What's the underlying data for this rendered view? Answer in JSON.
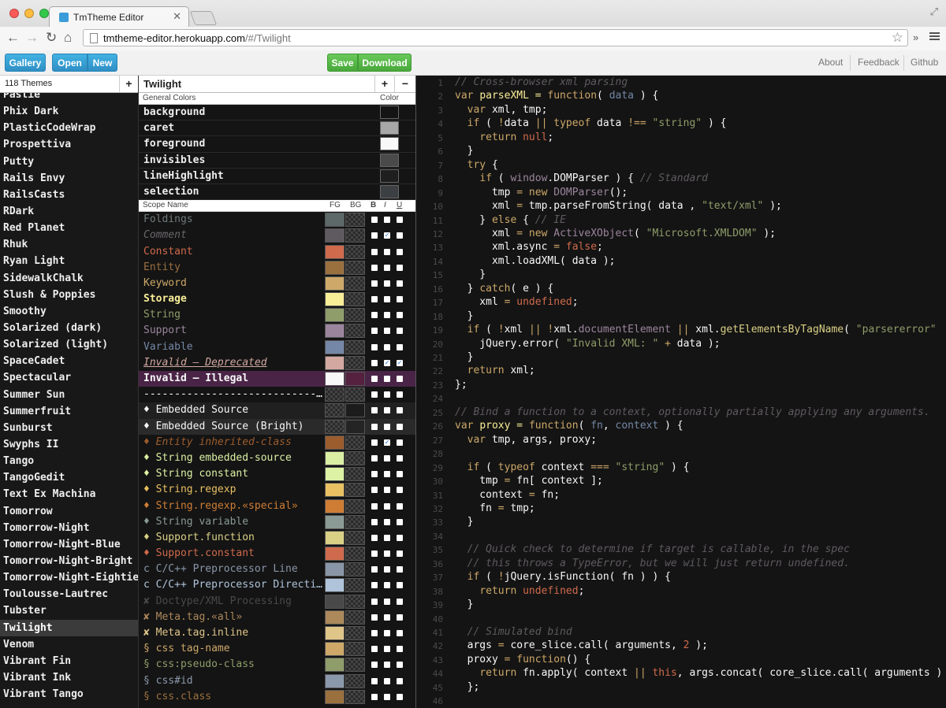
{
  "browser": {
    "tab_title": "TmTheme Editor",
    "url_host": "tmtheme-editor.herokuapp.com",
    "url_path": "/#/Twilight"
  },
  "appbar": {
    "gallery": "Gallery",
    "open": "Open",
    "new": "New",
    "save": "Save",
    "download": "Download",
    "about": "About",
    "feedback": "Feedback",
    "github": "Github"
  },
  "themes": {
    "count_label": "118 Themes",
    "add": "+",
    "selected": "Twilight",
    "items": [
      "Pastie",
      "Phix Dark",
      "PlasticCodeWrap",
      "Prospettiva",
      "Putty",
      "Rails Envy",
      "RailsCasts",
      "RDark",
      "Red Planet",
      "Rhuk",
      "Ryan Light",
      "SidewalkChalk",
      "Slush & Poppies",
      "Smoothy",
      "Solarized (dark)",
      "Solarized (light)",
      "SpaceCadet",
      "Spectacular",
      "Summer Sun",
      "Summerfruit",
      "Sunburst",
      "Swyphs II",
      "Tango",
      "TangoGedit",
      "Text Ex Machina",
      "Tomorrow",
      "Tomorrow-Night",
      "Tomorrow-Night-Blue",
      "Tomorrow-Night-Bright",
      "Tomorrow-Night-Eighties",
      "Toulousse-Lautrec",
      "Tubster",
      "Twilight",
      "Venom",
      "Vibrant Fin",
      "Vibrant Ink",
      "Vibrant Tango"
    ]
  },
  "editor": {
    "title": "Twilight",
    "add": "+",
    "remove": "−",
    "general_header": "General Colors",
    "color_header": "Color",
    "scope_header": "Scope Name",
    "fg_header": "FG",
    "bg_header": "BG",
    "b_header": "B",
    "i_header": "I",
    "u_header": "U",
    "general": [
      {
        "name": "background",
        "color": "#141414"
      },
      {
        "name": "caret",
        "color": "#a7a7a7"
      },
      {
        "name": "foreground",
        "color": "#f8f8f8"
      },
      {
        "name": "invisibles",
        "color": "#4a4a4a"
      },
      {
        "name": "lineHighlight",
        "color": "#1f1f1f"
      },
      {
        "name": "selection",
        "color": "#3c4043"
      }
    ],
    "scopes": [
      {
        "name": "Foldings",
        "fg": "#5c6968",
        "color": "#6f7a7a",
        "b": false,
        "i": false,
        "u": false
      },
      {
        "name": "Comment",
        "fg": "#5f5a60",
        "color": "#6a666b",
        "italic": true,
        "b": false,
        "i": true,
        "u": false
      },
      {
        "name": "Constant",
        "fg": "#cf6a4c",
        "color": "#cf6a4c",
        "b": false,
        "i": false,
        "u": false
      },
      {
        "name": "Entity",
        "fg": "#9b703f",
        "color": "#9b703f",
        "b": false,
        "i": false,
        "u": false
      },
      {
        "name": "Keyword",
        "fg": "#cda869",
        "color": "#cda869",
        "b": false,
        "i": false,
        "u": false
      },
      {
        "name": "Storage",
        "fg": "#f9ee98",
        "color": "#f9ee98",
        "bold": true,
        "b": false,
        "i": false,
        "u": false
      },
      {
        "name": "String",
        "fg": "#8f9d6a",
        "color": "#8f9d6a",
        "b": false,
        "i": false,
        "u": false
      },
      {
        "name": "Support",
        "fg": "#9b859d",
        "color": "#9b859d",
        "b": false,
        "i": false,
        "u": false
      },
      {
        "name": "Variable",
        "fg": "#7587a6",
        "color": "#7587a6",
        "b": false,
        "i": false,
        "u": false
      },
      {
        "name": "Invalid – Deprecated",
        "fg": "#d2a8a1",
        "color": "#d2a8a1",
        "italic": true,
        "underline": true,
        "b": false,
        "i": true,
        "u": true
      },
      {
        "name": "Invalid – Illegal",
        "fg": "#f8f8f8",
        "bgc": "#56203f",
        "color": "#f8f8f8",
        "rowbg": "#4a2447",
        "bold": true,
        "b": false,
        "i": false,
        "u": false
      },
      {
        "name": "-----------------------------------------------",
        "fg": "",
        "color": "#ffffff",
        "b": false,
        "i": false,
        "u": false
      },
      {
        "name": "♦ Embedded Source",
        "fg": "",
        "bgc": "#1c1c1c",
        "color": "#f8f8f8",
        "rowbg": "#202020",
        "b": false,
        "i": false,
        "u": false
      },
      {
        "name": "♦ Embedded Source (Bright)",
        "fg": "",
        "bgc": "#242424",
        "color": "#f8f8f8",
        "rowbg": "#2a2a2a",
        "b": false,
        "i": false,
        "u": false
      },
      {
        "name": "♦ Entity inherited-class",
        "fg": "#9b5c2e",
        "color": "#9b5c2e",
        "italic": true,
        "b": false,
        "i": true,
        "u": false
      },
      {
        "name": "♦ String embedded-source",
        "fg": "#daefa3",
        "color": "#daefa3",
        "b": false,
        "i": false,
        "u": false
      },
      {
        "name": "♦ String constant",
        "fg": "#ddf2a4",
        "color": "#ddf2a4",
        "b": false,
        "i": false,
        "u": false
      },
      {
        "name": "♦ String.regexp",
        "fg": "#e9c062",
        "color": "#e9c062",
        "b": false,
        "i": false,
        "u": false
      },
      {
        "name": "♦ String.regexp.«special»",
        "fg": "#cf7d34",
        "color": "#cf7d34",
        "b": false,
        "i": false,
        "u": false
      },
      {
        "name": "♦ String variable",
        "fg": "#8a9a95",
        "color": "#8a9a95",
        "b": false,
        "i": false,
        "u": false
      },
      {
        "name": "♦ Support.function",
        "fg": "#dad085",
        "color": "#dad085",
        "b": false,
        "i": false,
        "u": false
      },
      {
        "name": "♦ Support.constant",
        "fg": "#cf6a4c",
        "color": "#cf6a4c",
        "b": false,
        "i": false,
        "u": false
      },
      {
        "name": "c C/C++ Preprocessor Line",
        "fg": "#8996a8",
        "color": "#8996a8",
        "b": false,
        "i": false,
        "u": false
      },
      {
        "name": "c C/C++ Preprocessor Directive",
        "fg": "#afc4db",
        "color": "#afc4db",
        "b": false,
        "i": false,
        "u": false
      },
      {
        "name": "✘ Doctype/XML Processing",
        "fg": "#494949",
        "color": "#494949",
        "b": false,
        "i": false,
        "u": false
      },
      {
        "name": "✘ Meta.tag.«all»",
        "fg": "#ac885b",
        "color": "#ac885b",
        "b": false,
        "i": false,
        "u": false
      },
      {
        "name": "✘ Meta.tag.inline",
        "fg": "#e0c589",
        "color": "#e0c589",
        "b": false,
        "i": false,
        "u": false
      },
      {
        "name": "§ css tag-name",
        "fg": "#cda869",
        "color": "#cda869",
        "b": false,
        "i": false,
        "u": false
      },
      {
        "name": "§ css:pseudo-class",
        "fg": "#8f9d6a",
        "color": "#8f9d6a",
        "b": false,
        "i": false,
        "u": false
      },
      {
        "name": "§ css#id",
        "fg": "#8b98ab",
        "color": "#8b98ab",
        "b": false,
        "i": false,
        "u": false
      },
      {
        "name": "§ css.class",
        "fg": "#9b703f",
        "color": "#9b703f",
        "b": false,
        "i": false,
        "u": false
      }
    ]
  },
  "code": {
    "first_line": 1,
    "lines": [
      [
        [
          "c",
          "// Cross-browser xml parsing"
        ]
      ],
      [
        [
          "k",
          "var "
        ],
        [
          "n",
          "parseXML = "
        ],
        [
          "k",
          "function"
        ],
        [
          "p",
          "( "
        ],
        [
          "v",
          "data"
        ],
        [
          "p",
          " ) {"
        ]
      ],
      [
        [
          "p",
          "  "
        ],
        [
          "k",
          "var "
        ],
        [
          "p",
          "xml, tmp;"
        ]
      ],
      [
        [
          "p",
          "  "
        ],
        [
          "k",
          "if"
        ],
        [
          "p",
          " ( "
        ],
        [
          "k",
          "!"
        ],
        [
          "p",
          "data "
        ],
        [
          "k",
          "||"
        ],
        [
          "p",
          " "
        ],
        [
          "k",
          "typeof"
        ],
        [
          "p",
          " data "
        ],
        [
          "k",
          "!=="
        ],
        [
          "p",
          " "
        ],
        [
          "s",
          "\"string\""
        ],
        [
          "p",
          " ) {"
        ]
      ],
      [
        [
          "p",
          "    "
        ],
        [
          "k",
          "return"
        ],
        [
          "p",
          " "
        ],
        [
          "o",
          "null"
        ],
        [
          "p",
          ";"
        ]
      ],
      [
        [
          "p",
          "  }"
        ]
      ],
      [
        [
          "p",
          "  "
        ],
        [
          "k",
          "try"
        ],
        [
          "p",
          " {"
        ]
      ],
      [
        [
          "p",
          "    "
        ],
        [
          "k",
          "if"
        ],
        [
          "p",
          " ( "
        ],
        [
          "sp",
          "window"
        ],
        [
          "p",
          ".DOMParser ) { "
        ],
        [
          "c",
          "// Standard"
        ]
      ],
      [
        [
          "p",
          "      tmp "
        ],
        [
          "k",
          "= new "
        ],
        [
          "sp",
          "DOMParser"
        ],
        [
          "p",
          "();"
        ]
      ],
      [
        [
          "p",
          "      xml "
        ],
        [
          "k",
          "="
        ],
        [
          "p",
          " tmp.parseFromString( data , "
        ],
        [
          "s",
          "\"text/xml\""
        ],
        [
          "p",
          " );"
        ]
      ],
      [
        [
          "p",
          "    } "
        ],
        [
          "k",
          "else"
        ],
        [
          "p",
          " { "
        ],
        [
          "c",
          "// IE"
        ]
      ],
      [
        [
          "p",
          "      xml "
        ],
        [
          "k",
          "= new "
        ],
        [
          "sp",
          "ActiveXObject"
        ],
        [
          "p",
          "( "
        ],
        [
          "s",
          "\"Microsoft.XMLDOM\""
        ],
        [
          "p",
          " );"
        ]
      ],
      [
        [
          "p",
          "      xml.async "
        ],
        [
          "k",
          "="
        ],
        [
          "p",
          " "
        ],
        [
          "o",
          "false"
        ],
        [
          "p",
          ";"
        ]
      ],
      [
        [
          "p",
          "      xml.loadXML( data );"
        ]
      ],
      [
        [
          "p",
          "    }"
        ]
      ],
      [
        [
          "p",
          "  } "
        ],
        [
          "k",
          "catch"
        ],
        [
          "p",
          "( e ) {"
        ]
      ],
      [
        [
          "p",
          "    xml "
        ],
        [
          "k",
          "="
        ],
        [
          "p",
          " "
        ],
        [
          "o",
          "undefined"
        ],
        [
          "p",
          ";"
        ]
      ],
      [
        [
          "p",
          "  }"
        ]
      ],
      [
        [
          "p",
          "  "
        ],
        [
          "k",
          "if"
        ],
        [
          "p",
          " ( "
        ],
        [
          "k",
          "!"
        ],
        [
          "p",
          "xml "
        ],
        [
          "k",
          "||"
        ],
        [
          "p",
          " "
        ],
        [
          "k",
          "!"
        ],
        [
          "p",
          "xml."
        ],
        [
          "sp",
          "documentElement"
        ],
        [
          "p",
          " "
        ],
        [
          "k",
          "||"
        ],
        [
          "p",
          " xml."
        ],
        [
          "f",
          "getElementsByTagName"
        ],
        [
          "p",
          "( "
        ],
        [
          "s",
          "\"parsererror\""
        ]
      ],
      [
        [
          "p",
          "    jQuery.error( "
        ],
        [
          "s",
          "\"Invalid XML: \""
        ],
        [
          "p",
          " "
        ],
        [
          "k",
          "+"
        ],
        [
          "p",
          " data );"
        ]
      ],
      [
        [
          "p",
          "  }"
        ]
      ],
      [
        [
          "p",
          "  "
        ],
        [
          "k",
          "return"
        ],
        [
          "p",
          " xml;"
        ]
      ],
      [
        [
          "p",
          "};"
        ]
      ],
      [
        [
          "p",
          ""
        ]
      ],
      [
        [
          "c",
          "// Bind a function to a context, optionally partially applying any arguments."
        ]
      ],
      [
        [
          "k",
          "var "
        ],
        [
          "n",
          "proxy = "
        ],
        [
          "k",
          "function"
        ],
        [
          "p",
          "( "
        ],
        [
          "v",
          "fn"
        ],
        [
          "p",
          ", "
        ],
        [
          "v",
          "context"
        ],
        [
          "p",
          " ) {"
        ]
      ],
      [
        [
          "p",
          "  "
        ],
        [
          "k",
          "var "
        ],
        [
          "p",
          "tmp, args, proxy;"
        ]
      ],
      [
        [
          "p",
          ""
        ]
      ],
      [
        [
          "p",
          "  "
        ],
        [
          "k",
          "if"
        ],
        [
          "p",
          " ( "
        ],
        [
          "k",
          "typeof"
        ],
        [
          "p",
          " context "
        ],
        [
          "k",
          "==="
        ],
        [
          "p",
          " "
        ],
        [
          "s",
          "\"string\""
        ],
        [
          "p",
          " ) {"
        ]
      ],
      [
        [
          "p",
          "    tmp "
        ],
        [
          "k",
          "="
        ],
        [
          "p",
          " fn[ context ];"
        ]
      ],
      [
        [
          "p",
          "    context "
        ],
        [
          "k",
          "="
        ],
        [
          "p",
          " fn;"
        ]
      ],
      [
        [
          "p",
          "    fn "
        ],
        [
          "k",
          "="
        ],
        [
          "p",
          " tmp;"
        ]
      ],
      [
        [
          "p",
          "  }"
        ]
      ],
      [
        [
          "p",
          ""
        ]
      ],
      [
        [
          "p",
          "  "
        ],
        [
          "c",
          "// Quick check to determine if target is callable, in the spec"
        ]
      ],
      [
        [
          "p",
          "  "
        ],
        [
          "c",
          "// this throws a TypeError, but we will just return undefined."
        ]
      ],
      [
        [
          "p",
          "  "
        ],
        [
          "k",
          "if"
        ],
        [
          "p",
          " ( "
        ],
        [
          "k",
          "!"
        ],
        [
          "p",
          "jQuery.isFunction( fn ) ) {"
        ]
      ],
      [
        [
          "p",
          "    "
        ],
        [
          "k",
          "return"
        ],
        [
          "p",
          " "
        ],
        [
          "o",
          "undefined"
        ],
        [
          "p",
          ";"
        ]
      ],
      [
        [
          "p",
          "  }"
        ]
      ],
      [
        [
          "p",
          ""
        ]
      ],
      [
        [
          "p",
          "  "
        ],
        [
          "c",
          "// Simulated bind"
        ]
      ],
      [
        [
          "p",
          "  args "
        ],
        [
          "k",
          "="
        ],
        [
          "p",
          " core_slice.call( arguments, "
        ],
        [
          "o",
          "2"
        ],
        [
          "p",
          " );"
        ]
      ],
      [
        [
          "p",
          "  proxy "
        ],
        [
          "k",
          "= "
        ],
        [
          "k",
          "function"
        ],
        [
          "p",
          "() {"
        ]
      ],
      [
        [
          "p",
          "    "
        ],
        [
          "k",
          "return"
        ],
        [
          "p",
          " fn.apply( context "
        ],
        [
          "k",
          "||"
        ],
        [
          "p",
          " "
        ],
        [
          "o",
          "this"
        ],
        [
          "p",
          ", args.concat( core_slice.call( arguments ) )"
        ]
      ],
      [
        [
          "p",
          "  };"
        ]
      ],
      [
        [
          "p",
          ""
        ]
      ]
    ]
  },
  "colors": {
    "c": "#5f5a60",
    "k": "#cda869",
    "n": "#f9ee98",
    "v": "#7587a6",
    "p": "#f8f8f8",
    "s": "#8f9d6a",
    "o": "#cf6a4c",
    "sp": "#9b859d",
    "f": "#dad085"
  }
}
